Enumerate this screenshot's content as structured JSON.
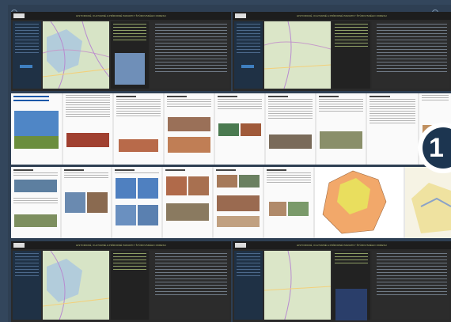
{
  "app": {
    "header_title": "HISTORICKÉ, KULTURNÉ A PRÍRODNÉ PAMIATKY ŠTÚROVSKÉHO OKRESU",
    "badge_number": "1"
  },
  "colors": {
    "background": "#33465c",
    "sidebar": "#1f3145",
    "accent_blue": "#3f7fc0",
    "map_land": "#d6e3c4",
    "map_yellow": "#e8dc5c",
    "map_orange": "#f0a060"
  },
  "icons": [
    "logo-icon",
    "map-icon",
    "photo-thumbnail",
    "badge-circle"
  ]
}
